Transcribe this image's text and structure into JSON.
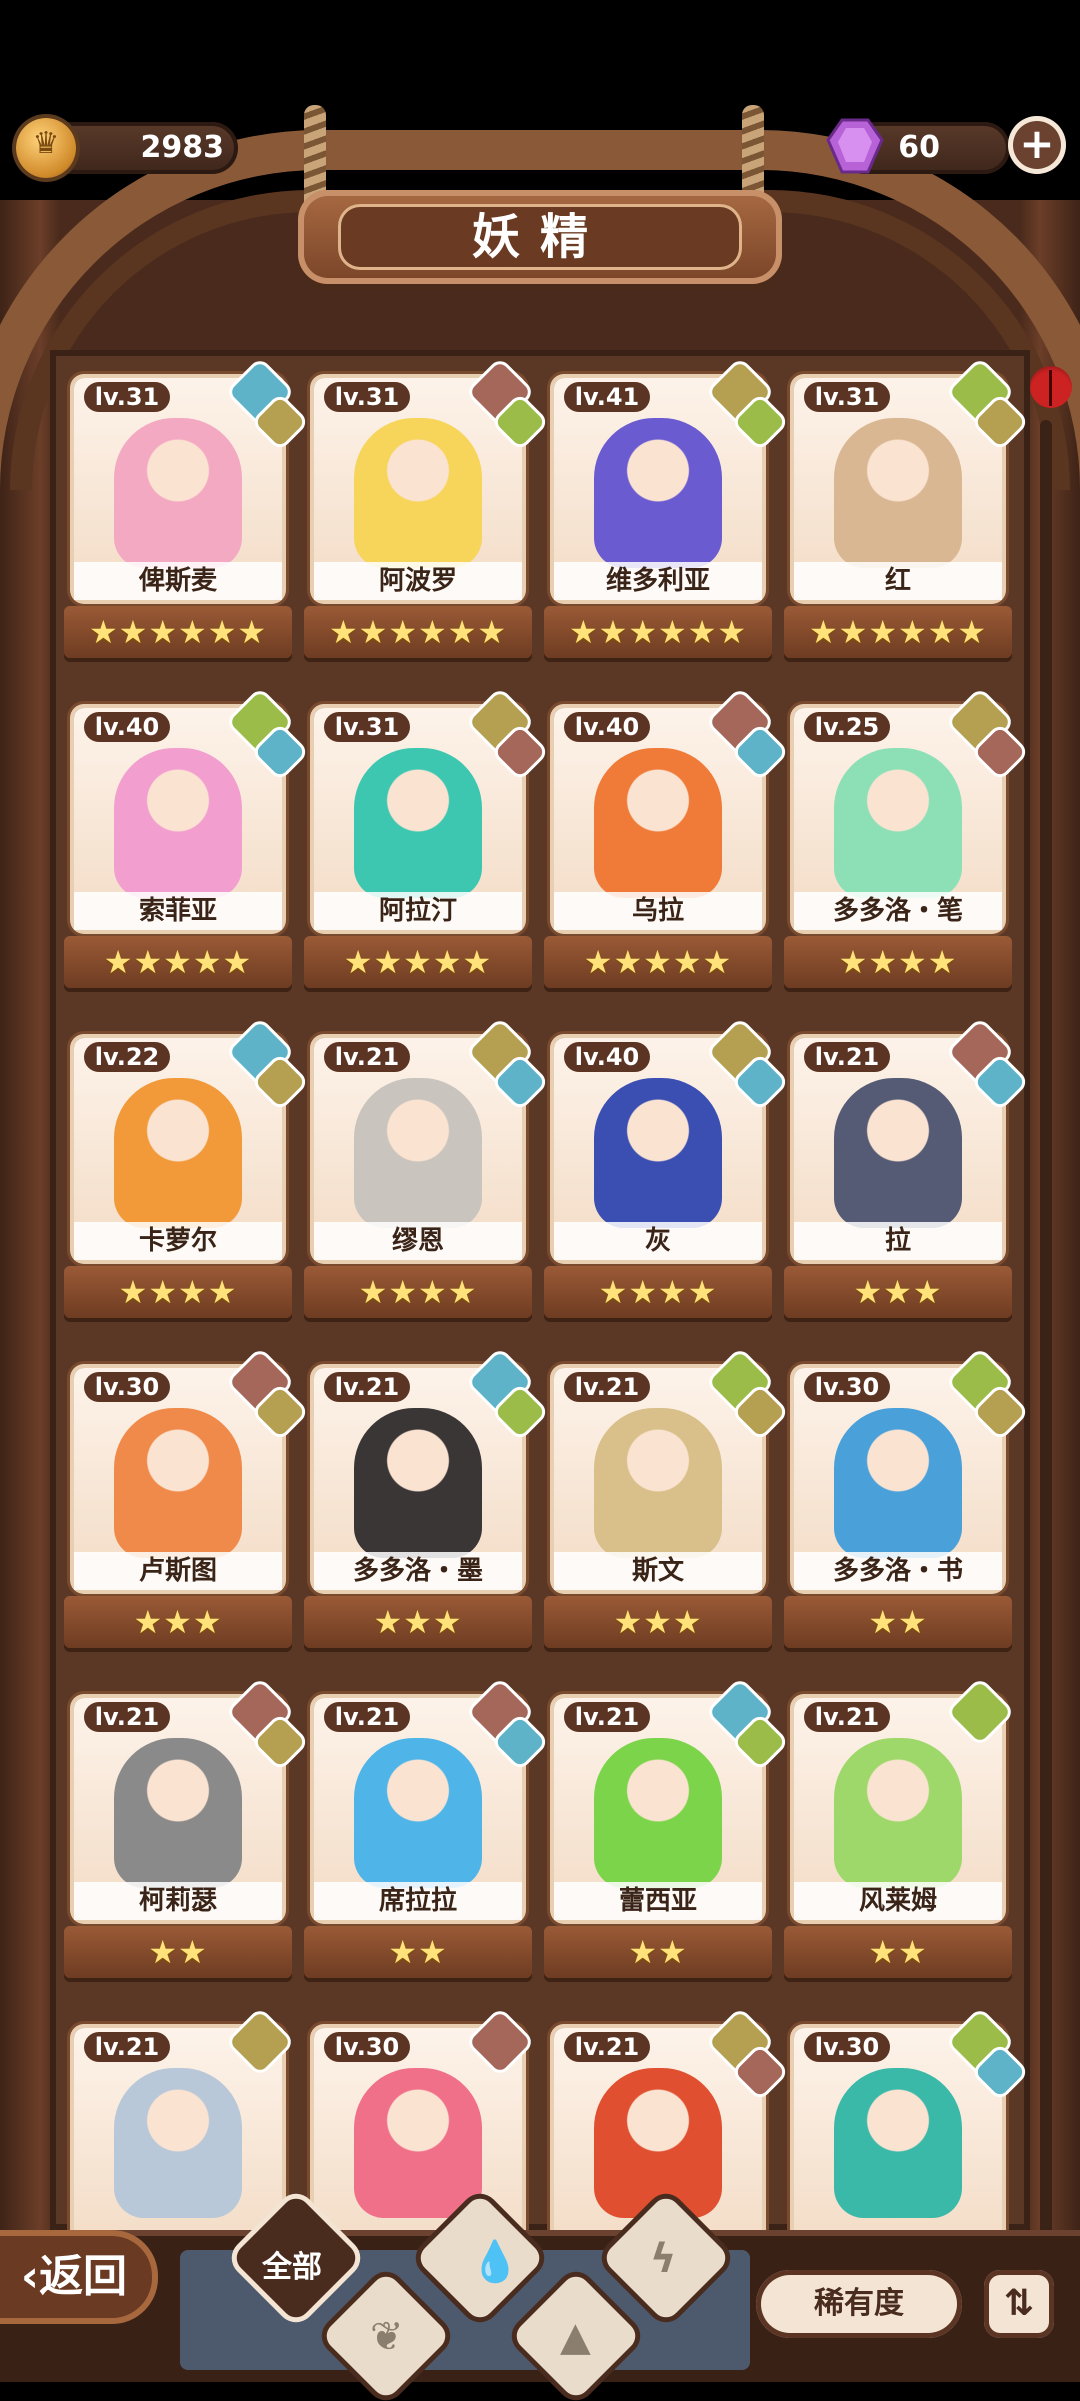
{
  "currency": {
    "coins": "2983",
    "gems": "60"
  },
  "title": "妖精",
  "fairies": [
    {
      "level": "lv.31",
      "name": "俾斯麦",
      "stars": "★★★★★★",
      "elements": [
        "water",
        "earth"
      ],
      "color": "#f4a9c3"
    },
    {
      "level": "lv.31",
      "name": "阿波罗",
      "stars": "★★★★★★",
      "elements": [
        "fire",
        "grass"
      ],
      "color": "#f7d45a"
    },
    {
      "level": "lv.41",
      "name": "维多利亚",
      "stars": "★★★★★★",
      "elements": [
        "earth",
        "grass"
      ],
      "color": "#6b5bd1"
    },
    {
      "level": "lv.31",
      "name": "红",
      "stars": "★★★★★★",
      "elements": [
        "grass",
        "earth"
      ],
      "color": "#d9b792"
    },
    {
      "level": "lv.40",
      "name": "索菲亚",
      "stars": "★★★★★",
      "elements": [
        "grass",
        "water"
      ],
      "color": "#f29fd0"
    },
    {
      "level": "lv.31",
      "name": "阿拉汀",
      "stars": "★★★★★",
      "elements": [
        "earth",
        "fire"
      ],
      "color": "#3ec7b0"
    },
    {
      "level": "lv.40",
      "name": "乌拉",
      "stars": "★★★★★",
      "elements": [
        "fire",
        "water"
      ],
      "color": "#f07a38"
    },
    {
      "level": "lv.25",
      "name": "多多洛・笔",
      "stars": "★★★★",
      "elements": [
        "earth",
        "fire"
      ],
      "color": "#8de0b6"
    },
    {
      "level": "lv.22",
      "name": "卡萝尔",
      "stars": "★★★★",
      "elements": [
        "water",
        "earth"
      ],
      "color": "#f29a3a"
    },
    {
      "level": "lv.21",
      "name": "缪恩",
      "stars": "★★★★",
      "elements": [
        "earth",
        "water"
      ],
      "color": "#c9c4bd"
    },
    {
      "level": "lv.40",
      "name": "灰",
      "stars": "★★★★",
      "elements": [
        "earth",
        "water"
      ],
      "color": "#3b4fb2"
    },
    {
      "level": "lv.21",
      "name": "拉",
      "stars": "★★★",
      "elements": [
        "fire",
        "water"
      ],
      "color": "#555b74"
    },
    {
      "level": "lv.30",
      "name": "卢斯图",
      "stars": "★★★",
      "elements": [
        "fire",
        "earth"
      ],
      "color": "#f08a4a"
    },
    {
      "level": "lv.21",
      "name": "多多洛・墨",
      "stars": "★★★",
      "elements": [
        "water",
        "grass"
      ],
      "color": "#3a3636"
    },
    {
      "level": "lv.21",
      "name": "斯文",
      "stars": "★★★",
      "elements": [
        "grass",
        "earth"
      ],
      "color": "#d9c08a"
    },
    {
      "level": "lv.30",
      "name": "多多洛・书",
      "stars": "★★",
      "elements": [
        "grass",
        "earth"
      ],
      "color": "#4aa0d8"
    },
    {
      "level": "lv.21",
      "name": "柯莉瑟",
      "stars": "★★",
      "elements": [
        "fire",
        "earth"
      ],
      "color": "#8a8a8a"
    },
    {
      "level": "lv.21",
      "name": "席拉拉",
      "stars": "★★",
      "elements": [
        "fire",
        "water"
      ],
      "color": "#4fb4e8"
    },
    {
      "level": "lv.21",
      "name": "蕾西亚",
      "stars": "★★",
      "elements": [
        "water",
        "grass"
      ],
      "color": "#7cd44a"
    },
    {
      "level": "lv.21",
      "name": "风莱姆",
      "stars": "★★",
      "elements": [
        "grass"
      ],
      "color": "#9ed86a"
    },
    {
      "level": "lv.21",
      "name": "",
      "stars": "",
      "elements": [
        "earth"
      ],
      "color": "#b8c8d8"
    },
    {
      "level": "lv.30",
      "name": "",
      "stars": "",
      "elements": [
        "fire"
      ],
      "color": "#f0708a"
    },
    {
      "level": "lv.21",
      "name": "",
      "stars": "",
      "elements": [
        "earth",
        "fire"
      ],
      "color": "#e05030"
    },
    {
      "level": "lv.30",
      "name": "",
      "stars": "",
      "elements": [
        "grass",
        "water"
      ],
      "color": "#3ab8a8"
    }
  ],
  "bottom": {
    "back_label": "返回",
    "all_label": "全部",
    "rarity_label": "稀有度",
    "filters": [
      "water-icon",
      "grass-icon",
      "earth-icon",
      "fire-icon"
    ]
  }
}
